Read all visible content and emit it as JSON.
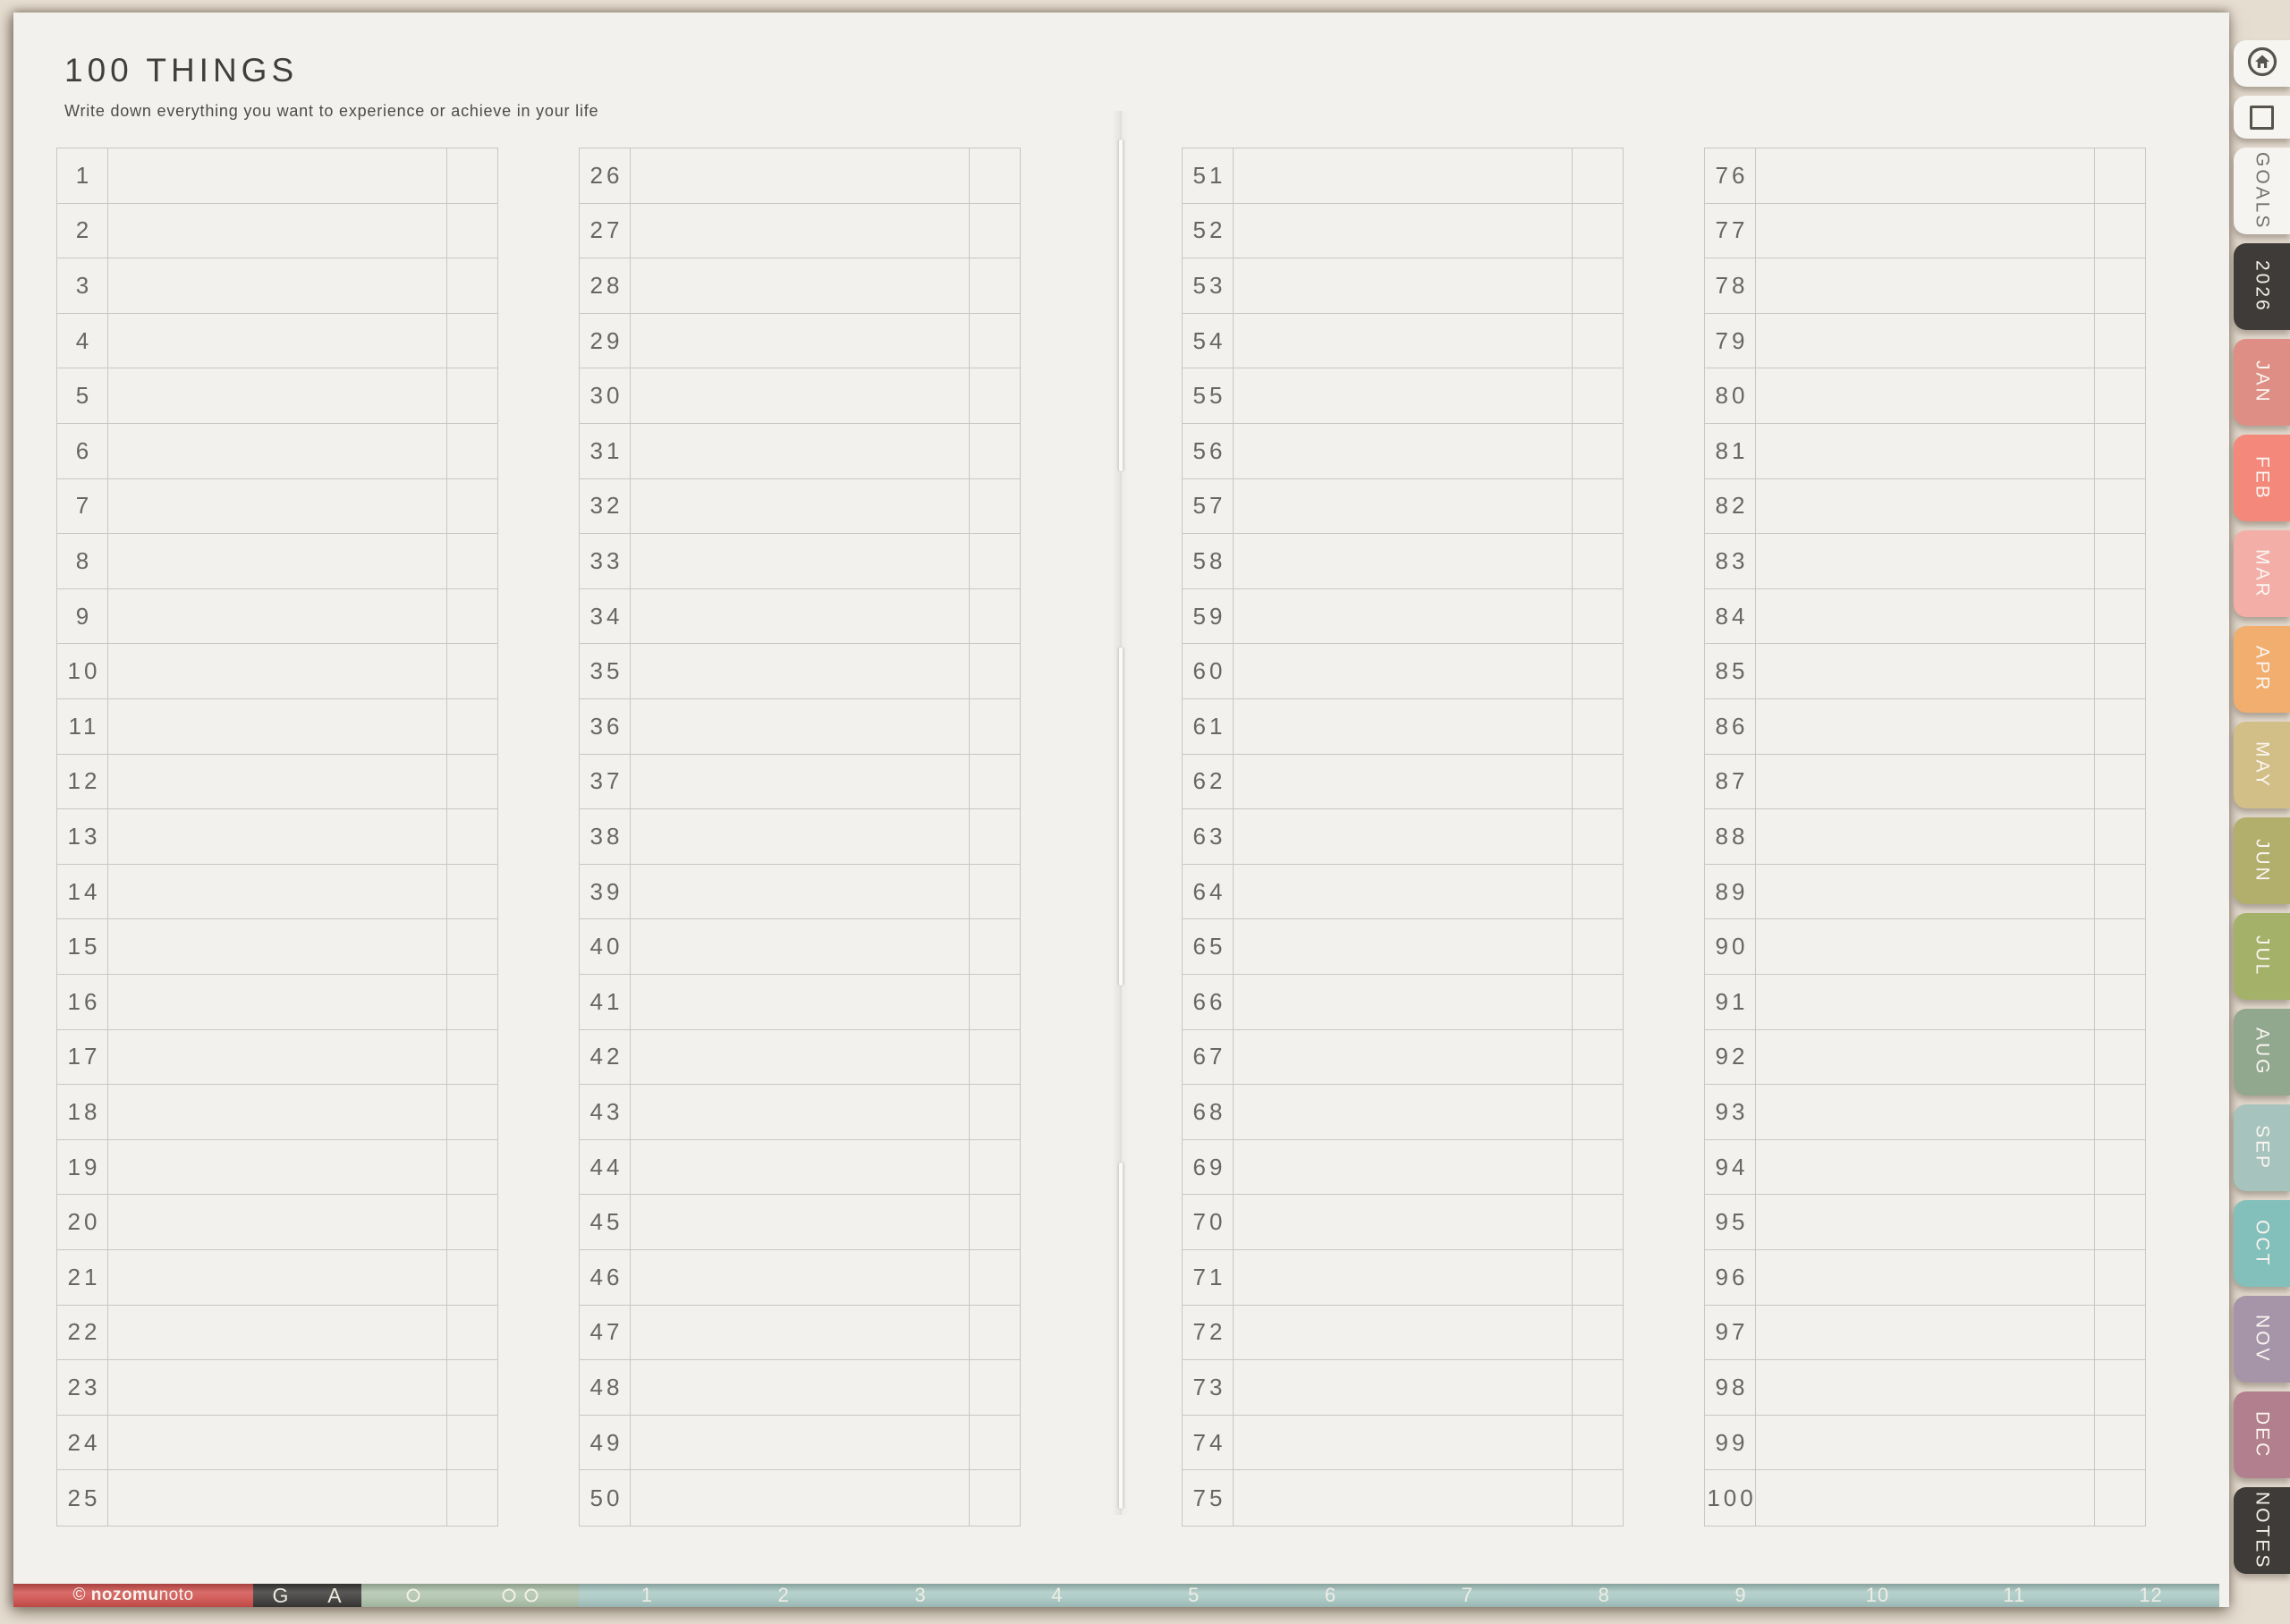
{
  "page": {
    "title": "100 THINGS",
    "subtitle": "Write down everything you want to experience or achieve in your life"
  },
  "list": {
    "columns": [
      {
        "numbers": [
          1,
          2,
          3,
          4,
          5,
          6,
          7,
          8,
          9,
          10,
          11,
          12,
          13,
          14,
          15,
          16,
          17,
          18,
          19,
          20,
          21,
          22,
          23,
          24,
          25
        ]
      },
      {
        "numbers": [
          26,
          27,
          28,
          29,
          30,
          31,
          32,
          33,
          34,
          35,
          36,
          37,
          38,
          39,
          40,
          41,
          42,
          43,
          44,
          45,
          46,
          47,
          48,
          49,
          50
        ]
      },
      {
        "numbers": [
          51,
          52,
          53,
          54,
          55,
          56,
          57,
          58,
          59,
          60,
          61,
          62,
          63,
          64,
          65,
          66,
          67,
          68,
          69,
          70,
          71,
          72,
          73,
          74,
          75
        ]
      },
      {
        "numbers": [
          76,
          77,
          78,
          79,
          80,
          81,
          82,
          83,
          84,
          85,
          86,
          87,
          88,
          89,
          90,
          91,
          92,
          93,
          94,
          95,
          96,
          97,
          98,
          99,
          100
        ]
      }
    ]
  },
  "sidebar": {
    "icon_tabs": [
      {
        "icon": "home-icon"
      },
      {
        "icon": "square-icon"
      }
    ],
    "default_fg": "#faf5f1",
    "tabs": [
      {
        "label": "GOALS",
        "bg": "#f6f4f1",
        "fg": "#73716d"
      },
      {
        "label": "2026",
        "bg": "#3e3b38",
        "fg": "#f4f1ec"
      },
      {
        "label": "JAN",
        "bg": "#de8e84"
      },
      {
        "label": "FEB",
        "bg": "#f4897b"
      },
      {
        "label": "MAR",
        "bg": "#f4aea8"
      },
      {
        "label": "APR",
        "bg": "#f1ae6f"
      },
      {
        "label": "MAY",
        "bg": "#d2bf87"
      },
      {
        "label": "JUN",
        "bg": "#b2ae6c"
      },
      {
        "label": "JUL",
        "bg": "#a4b269"
      },
      {
        "label": "AUG",
        "bg": "#91a88f"
      },
      {
        "label": "SEP",
        "bg": "#a6c4bd"
      },
      {
        "label": "OCT",
        "bg": "#83bfbb"
      },
      {
        "label": "NOV",
        "bg": "#a694a8"
      },
      {
        "label": "DEC",
        "bg": "#b17f8d"
      },
      {
        "label": "NOTES",
        "bg": "#3e3b38",
        "fg": "#f4f1ec"
      }
    ]
  },
  "bottom_bar": {
    "copyright_symbol": "©",
    "brand_bold": "nozomu",
    "brand_light": "noto",
    "nav_g": "G",
    "nav_a": "A",
    "dot_count": 3,
    "months": [
      "1",
      "2",
      "3",
      "4",
      "5",
      "6",
      "7",
      "8",
      "9",
      "10",
      "11",
      "12"
    ],
    "colors": {
      "red": "#d0504d",
      "dark": "#3b3937",
      "sage": "#aec3ab",
      "teal": "#a8c8c3"
    }
  },
  "colors": {
    "background": "#e6ddd1",
    "page": "#f3f1ee",
    "grid_line": "#c8c7c4",
    "text": "#413f3c"
  }
}
